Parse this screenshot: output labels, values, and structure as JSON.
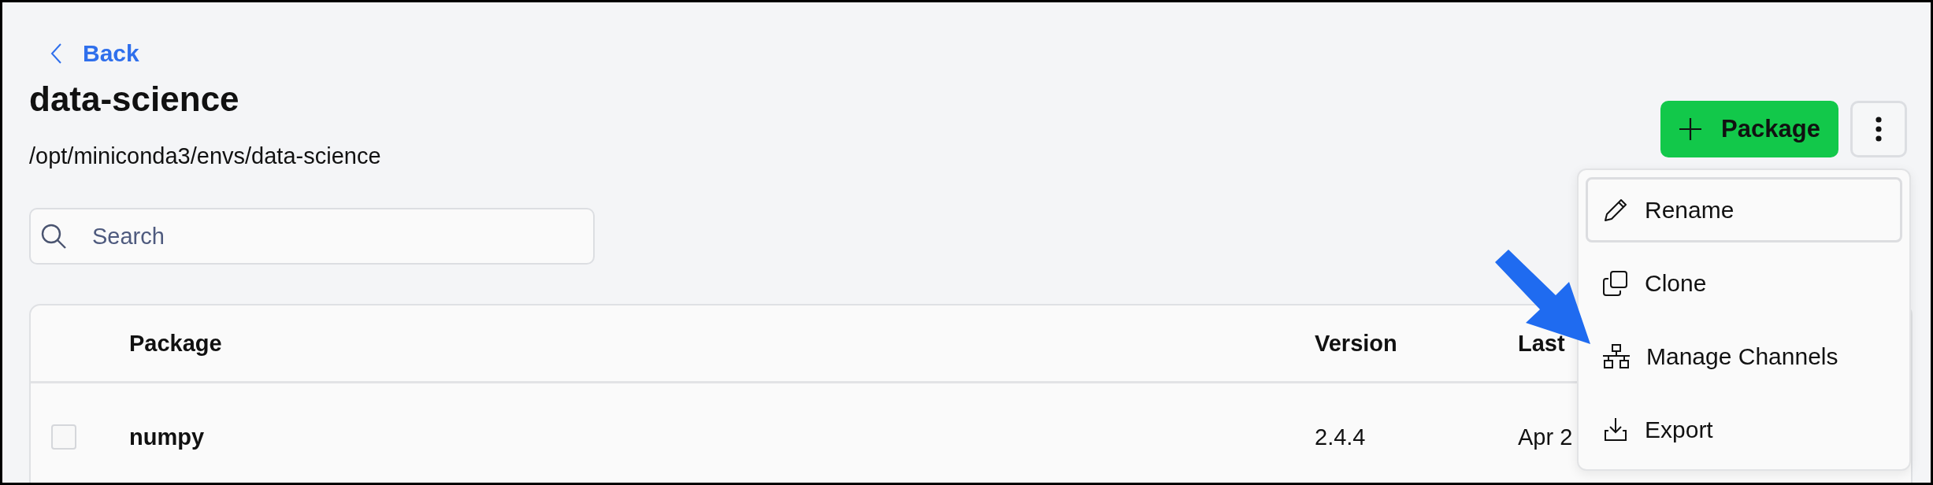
{
  "back_link": {
    "label": "Back"
  },
  "title": "data-science",
  "path": "/opt/miniconda3/envs/data-science",
  "search": {
    "placeholder": "Search"
  },
  "actions": {
    "add_button": "Package"
  },
  "menu": {
    "items": [
      {
        "kind": "rename",
        "label": "Rename",
        "selected": true
      },
      {
        "kind": "clone",
        "label": "Clone",
        "selected": false
      },
      {
        "kind": "channels",
        "label": "Manage Channels",
        "selected": false
      },
      {
        "kind": "export",
        "label": "Export",
        "selected": false
      }
    ]
  },
  "table": {
    "columns": [
      "Package",
      "Version",
      "Last"
    ],
    "rows": [
      {
        "checked": false,
        "cells": [
          "numpy",
          "2.4.4",
          "Apr 2"
        ]
      }
    ]
  }
}
